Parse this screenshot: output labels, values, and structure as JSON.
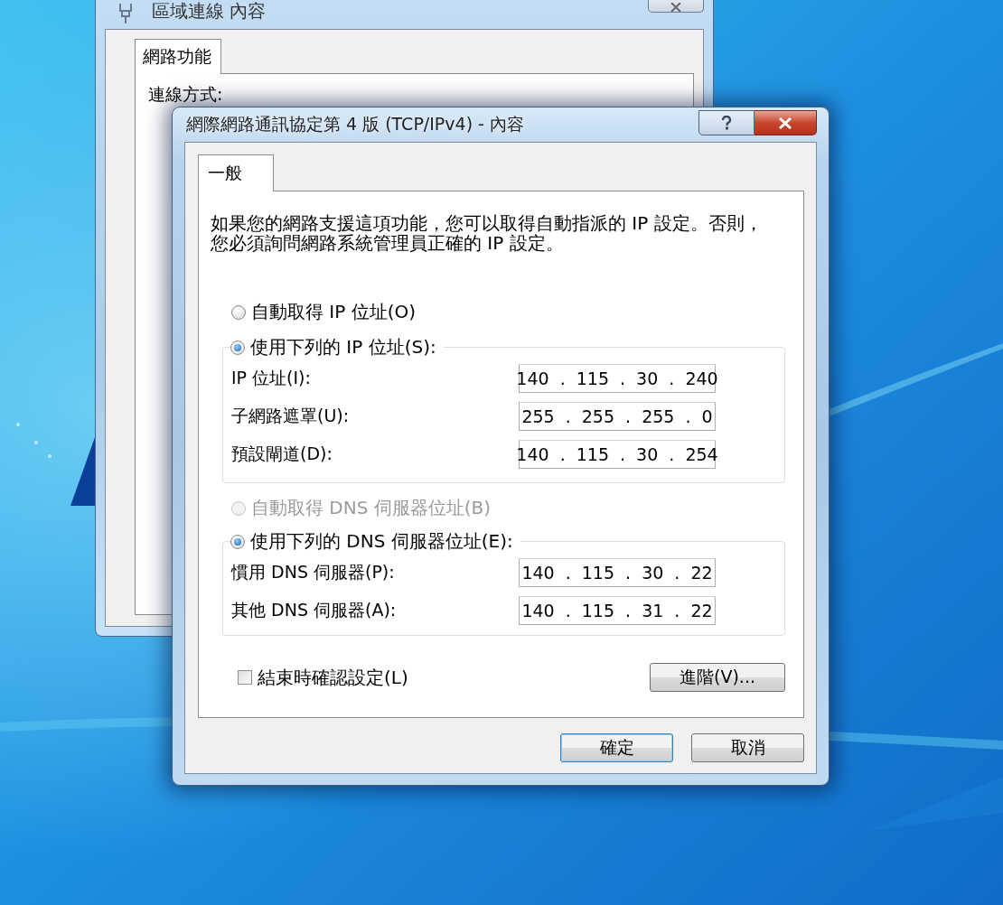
{
  "back_window": {
    "title": "區域連線 內容",
    "tabs": [
      {
        "label": "網路功能",
        "selected": true
      }
    ],
    "section_label": "連線方式:"
  },
  "dialog": {
    "title": "網際網路通訊協定第 4 版 (TCP/IPv4) - 內容",
    "tabs": [
      {
        "label": "一般",
        "selected": true
      }
    ],
    "description": "如果您的網路支援這項功能，您可以取得自動指派的 IP 設定。否則，您必須詢問網路系統管理員正確的 IP 設定。",
    "ip_options": [
      {
        "label": "自動取得 IP 位址(O)",
        "selected": false,
        "disabled": false
      },
      {
        "label": "使用下列的 IP 位址(S):",
        "selected": true,
        "disabled": false
      }
    ],
    "ip_fields": [
      {
        "label": "IP 位址(I):",
        "value": "140 . 115 . 30 . 240"
      },
      {
        "label": "子網路遮罩(U):",
        "value": "255 . 255 . 255 . 0"
      },
      {
        "label": "預設閘道(D):",
        "value": "140 . 115 . 30 . 254"
      }
    ],
    "dns_options": [
      {
        "label": "自動取得 DNS 伺服器位址(B)",
        "selected": false,
        "disabled": true
      },
      {
        "label": "使用下列的 DNS 伺服器位址(E):",
        "selected": true,
        "disabled": false
      }
    ],
    "dns_fields": [
      {
        "label": "慣用 DNS 伺服器(P):",
        "value": "140 . 115 . 30 . 22"
      },
      {
        "label": "其他 DNS 伺服器(A):",
        "value": "140 . 115 . 31 . 22"
      }
    ],
    "confirm_checkbox": {
      "label": "結束時確認設定(L)",
      "checked": false
    },
    "advanced_button": "進階(V)...",
    "buttons": [
      {
        "label": "確定",
        "default": true
      },
      {
        "label": "取消",
        "default": false
      }
    ]
  }
}
